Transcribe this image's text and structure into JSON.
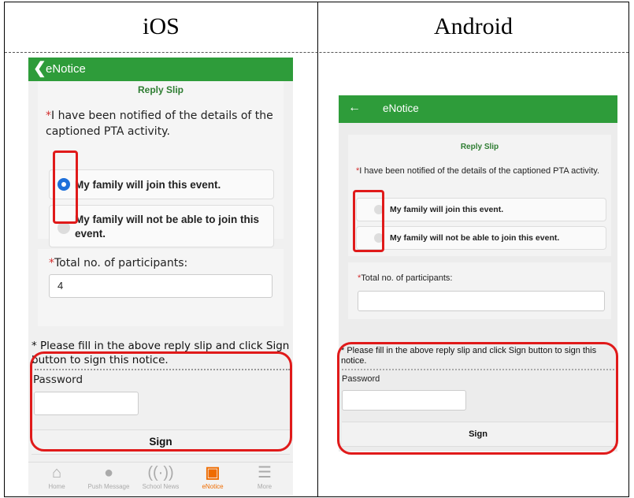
{
  "columns": {
    "left_title": "iOS",
    "right_title": "Android"
  },
  "ios": {
    "nav_title": "eNotice",
    "reply_title": "Reply Slip",
    "question_star": "*",
    "question": "I have been notified of the details of the captioned PTA activity.",
    "options": [
      {
        "label": "My family will join this event.",
        "selected": true
      },
      {
        "label": "My family will not be able to join this event.",
        "selected": false
      }
    ],
    "total_label": "Total no. of participants:",
    "total_value": "4",
    "note": "* Please fill in the above reply slip and click Sign button to sign this notice.",
    "password_label": "Password",
    "password_value": "",
    "sign_label": "Sign",
    "tabs": [
      {
        "label": "Home",
        "icon": "home-icon"
      },
      {
        "label": "Push Message",
        "icon": "message-icon"
      },
      {
        "label": "School News",
        "icon": "broadcast-icon"
      },
      {
        "label": "eNotice",
        "icon": "enotice-icon"
      },
      {
        "label": "More",
        "icon": "menu-icon"
      }
    ]
  },
  "android": {
    "nav_title": "eNotice",
    "reply_title": "Reply Slip",
    "question_star": "*",
    "question": "I have been notified of the details of the captioned PTA activity.",
    "options": [
      {
        "label": "My family will join this event.",
        "selected": false
      },
      {
        "label": "My family will not be able to join this event.",
        "selected": false
      }
    ],
    "total_label": "Total no. of participants:",
    "total_value": "",
    "note": "* Please fill in the above reply slip and click Sign button to sign this notice.",
    "password_label": "Password",
    "password_value": "",
    "sign_label": "Sign"
  },
  "colors": {
    "nav_green": "#2e9c3a",
    "highlight_red": "#e01a1a",
    "radio_blue": "#1e6fd9",
    "active_tab": "#ef6c00"
  }
}
